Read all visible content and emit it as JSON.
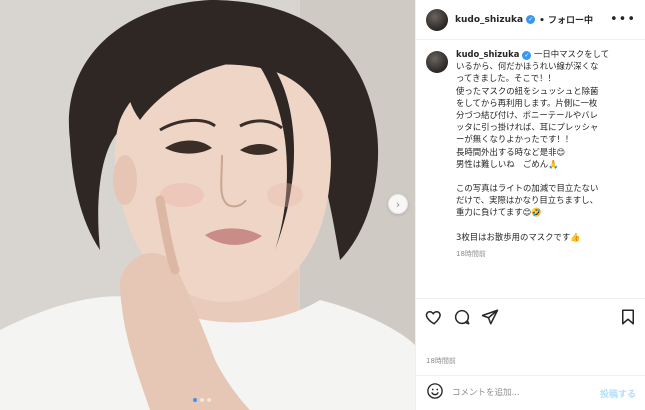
{
  "post": {
    "username": "kudo_shizuka",
    "follow_label": "• フォロー中",
    "more_label": "•••",
    "caption_lines": [
      "一日中マスクをして",
      "いるから、何だかほうれい線が深くな",
      "ってきました。そこで！！",
      "使ったマスクの紐をシュッシュと除菌",
      "をしてから再利用します。片側に一枚",
      "分づつ結び付け、ポニーテールやバレ",
      "ッタに引っ掛ければ、耳にプレッシャ",
      "ーが無くなりよかったです！！",
      "長時間外出する時など是非😊",
      "男性は難しいね　ごめん🙏",
      "",
      "この写真はライトの加減で目立たない",
      "だけで、実際はかなり目立ちますし、",
      "重力に負けてます😊🤣",
      "",
      "3枚目はお散歩用のマスクです👍"
    ],
    "caption_time": "18時間前",
    "post_time": "18時間前"
  },
  "comment": {
    "placeholder": "コメントを追加...",
    "post_label": "投稿する"
  },
  "icons": {
    "like": "heart-icon",
    "comment": "comment-icon",
    "share": "share-icon",
    "save": "bookmark-icon",
    "emoji": "emoji-icon",
    "next": "chevron-right-icon"
  },
  "carousel": {
    "slides": 3,
    "active_index": 0
  },
  "colors": {
    "accent": "#3897f0",
    "post_button": "#b2dffc",
    "muted_text": "#8e8e8e"
  }
}
